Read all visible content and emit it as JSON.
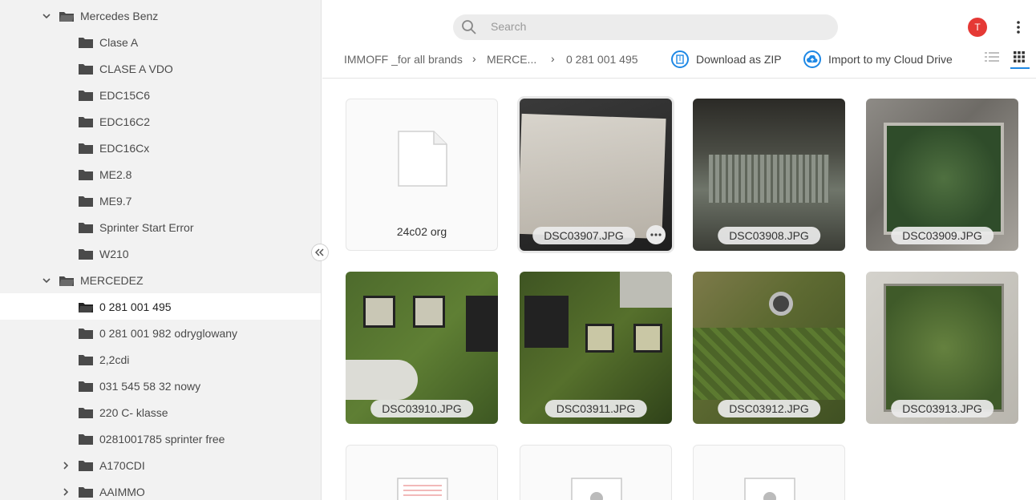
{
  "sidebar": {
    "rows": [
      {
        "label": "Mercedes Benz",
        "level": 0,
        "expand": "down"
      },
      {
        "label": "Clase A",
        "level": 1
      },
      {
        "label": "CLASE A VDO",
        "level": 1
      },
      {
        "label": "EDC15C6",
        "level": 1
      },
      {
        "label": "EDC16C2",
        "level": 1
      },
      {
        "label": "EDC16Cx",
        "level": 1
      },
      {
        "label": "ME2.8",
        "level": 1
      },
      {
        "label": "ME9.7",
        "level": 1
      },
      {
        "label": "Sprinter Start Error",
        "level": 1
      },
      {
        "label": "W210",
        "level": 1
      },
      {
        "label": "MERCEDEZ",
        "level": 0,
        "expand": "down"
      },
      {
        "label": "0 281 001 495",
        "level": 1,
        "selected": true
      },
      {
        "label": "0 281 001 982 odryglowany",
        "level": 1
      },
      {
        "label": "2,2cdi",
        "level": 1
      },
      {
        "label": "031 545 58 32 nowy",
        "level": 1
      },
      {
        "label": "220 C- klasse",
        "level": 1
      },
      {
        "label": "0281001785 sprinter free",
        "level": 1
      },
      {
        "label": "A170CDI",
        "level": 1,
        "expand": "right"
      },
      {
        "label": "AAIMMO",
        "level": 1,
        "expand": "right"
      }
    ]
  },
  "search": {
    "placeholder": "Search"
  },
  "user": {
    "initial": "T",
    "color": "#e53935"
  },
  "breadcrumb": {
    "items": [
      "IMMOFF _for all brands",
      "MERCE...",
      "0 281 001 495"
    ]
  },
  "toolbar": {
    "download_label": "Download as ZIP",
    "import_label": "Import to my Cloud Drive",
    "accent": "#1e88e5"
  },
  "files": [
    {
      "name": "24c02 org",
      "kind": "file"
    },
    {
      "name": "DSC03907.JPG",
      "kind": "photo",
      "hover": true
    },
    {
      "name": "DSC03908.JPG",
      "kind": "photo"
    },
    {
      "name": "DSC03909.JPG",
      "kind": "photo"
    },
    {
      "name": "DSC03910.JPG",
      "kind": "photo"
    },
    {
      "name": "DSC03911.JPG",
      "kind": "photo"
    },
    {
      "name": "DSC03912.JPG",
      "kind": "photo"
    },
    {
      "name": "DSC03913.JPG",
      "kind": "photo"
    },
    {
      "name": "",
      "kind": "text-doc"
    },
    {
      "name": "",
      "kind": "settings-file"
    },
    {
      "name": "",
      "kind": "settings-file"
    }
  ]
}
